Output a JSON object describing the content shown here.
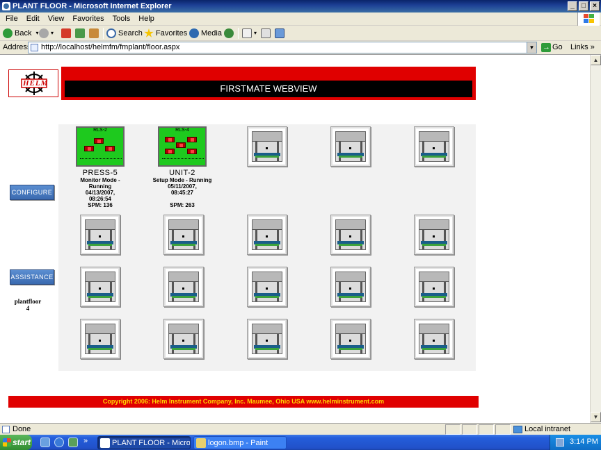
{
  "window": {
    "title": "PLANT FLOOR - Microsoft Internet Explorer",
    "controls": {
      "minimize": "_",
      "maximize": "□",
      "close": "×"
    }
  },
  "menu": [
    "File",
    "Edit",
    "View",
    "Favorites",
    "Tools",
    "Help"
  ],
  "toolbar": {
    "back": "Back",
    "search": "Search",
    "favorites": "Favorites",
    "media": "Media"
  },
  "address": {
    "label": "Address",
    "url": "http://localhost/helmfm/fmplant/floor.aspx",
    "go": "Go",
    "links": "Links"
  },
  "page": {
    "logo_text": "HELM",
    "header_title": "FIRSTMATE WEBVIEW",
    "configure": "CONFIGURE",
    "assistance": "ASSISTANCE",
    "plantfloor_label": "plantfloor",
    "plantfloor_num": "4",
    "footer": "Copyright 2006: Helm Instrument Company, Inc.   Maumee, Ohio USA  www.helminstrument.com",
    "machines": [
      {
        "screen": "RLS-2",
        "name": "PRESS-5",
        "line1": "Monitor Mode -",
        "line2": "Running",
        "line3": "04/13/2007,",
        "line4": "08:26:54",
        "line5": "SPM: 136"
      },
      {
        "screen": "RLS-4",
        "name": "UNIT-2",
        "line1": "Setup Mode - Running",
        "line2": "05/11/2007,",
        "line3": "08:45:27",
        "line4": "",
        "line5": "SPM: 263"
      }
    ]
  },
  "status": {
    "text": "Done",
    "zone": "Local intranet"
  },
  "taskbar": {
    "start": "start",
    "tasks": [
      "PLANT FLOOR - Micros...",
      "logon.bmp - Paint"
    ],
    "clock": "3:14 PM"
  },
  "colors": {
    "header_red": "#e00000",
    "active_machine_green": "#1ec91e",
    "footer_text": "#ffd500",
    "button_blue": "#3a6ab0"
  }
}
